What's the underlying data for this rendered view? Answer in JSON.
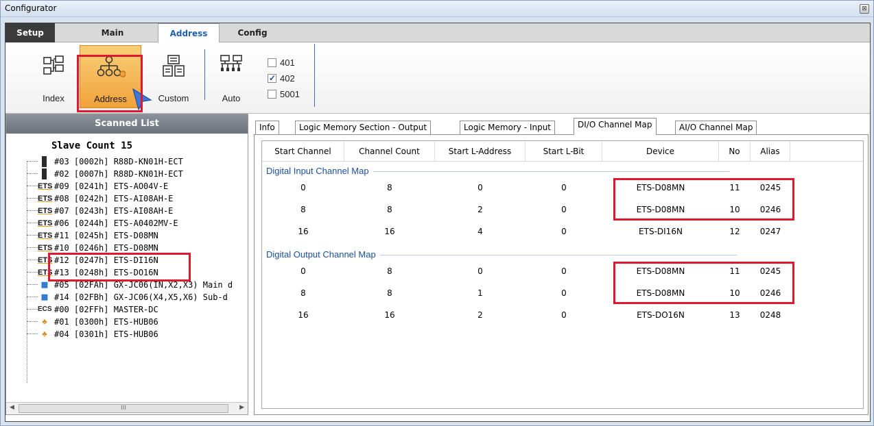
{
  "window": {
    "title": "Configurator",
    "close_glyph": "⊠"
  },
  "ribbon_tabs": [
    "Setup",
    "Main",
    "Address",
    "Config"
  ],
  "toolbar": {
    "index_label": "Index",
    "address_label": "Address",
    "custom_label": "Custom",
    "auto_label": "Auto",
    "checkboxes": [
      {
        "label": "401",
        "checked": false
      },
      {
        "label": "402",
        "checked": true
      },
      {
        "label": "5001",
        "checked": false
      }
    ]
  },
  "scanned_list": {
    "header": "Scanned List",
    "slave_count": "Slave Count  15",
    "items": [
      {
        "icon": "servo-icon",
        "text": "#03  [0002h] R88D-KN01H-ECT"
      },
      {
        "icon": "servo-icon",
        "text": "#02  [0007h] R88D-KN01H-ECT"
      },
      {
        "icon": "ets-icon",
        "text": "#09  [0241h] ETS-AO04V-E"
      },
      {
        "icon": "ets-icon",
        "text": "#08  [0242h] ETS-AI08AH-E"
      },
      {
        "icon": "ets-icon",
        "text": "#07  [0243h] ETS-AI08AH-E"
      },
      {
        "icon": "ets-icon",
        "text": "#06  [0244h] ETS-A0402MV-E"
      },
      {
        "icon": "ets-icon",
        "text": "#11  [0245h] ETS-D08MN"
      },
      {
        "icon": "ets-icon",
        "text": "#10  [0246h] ETS-D08MN"
      },
      {
        "icon": "ets-icon",
        "text": "#12  [0247h] ETS-DI16N"
      },
      {
        "icon": "ets-icon",
        "text": "#13  [0248h] ETS-DO16N"
      },
      {
        "icon": "gx-icon",
        "text": "#05  [02FAh] GX-JC06(IN,X2,X3) Main d"
      },
      {
        "icon": "gx-icon",
        "text": "#14  [02FBh] GX-JC06(X4,X5,X6) Sub-d"
      },
      {
        "icon": "ecs-icon",
        "text": "#00  [02FFh] MASTER-DC"
      },
      {
        "icon": "hub-icon",
        "text": "#01  [0300h] ETS-HUB06"
      },
      {
        "icon": "hub-icon",
        "text": "#04  [0301h] ETS-HUB06"
      }
    ],
    "scroll_thumb": "III"
  },
  "panel_tabs": [
    "Info",
    "Logic Memory Section - Output",
    "Logic Memory - Input",
    "DI/O Channel Map",
    "AI/O Channel Map"
  ],
  "grid": {
    "headers": [
      "Start Channel",
      "Channel Count",
      "Start L-Address",
      "Start L-Bit",
      "Device",
      "No",
      "Alias"
    ],
    "input_section": "Digital Input Channel Map",
    "input_rows": [
      [
        "0",
        "8",
        "0",
        "0",
        "ETS-D08MN",
        "11",
        "0245"
      ],
      [
        "8",
        "8",
        "2",
        "0",
        "ETS-D08MN",
        "10",
        "0246"
      ],
      [
        "16",
        "16",
        "4",
        "0",
        "ETS-DI16N",
        "12",
        "0247"
      ]
    ],
    "output_section": "Digital Output Channel Map",
    "output_rows": [
      [
        "0",
        "8",
        "0",
        "0",
        "ETS-D08MN",
        "11",
        "0245"
      ],
      [
        "8",
        "8",
        "1",
        "0",
        "ETS-D08MN",
        "10",
        "0246"
      ],
      [
        "16",
        "16",
        "2",
        "0",
        "ETS-DO16N",
        "13",
        "0248"
      ]
    ]
  }
}
